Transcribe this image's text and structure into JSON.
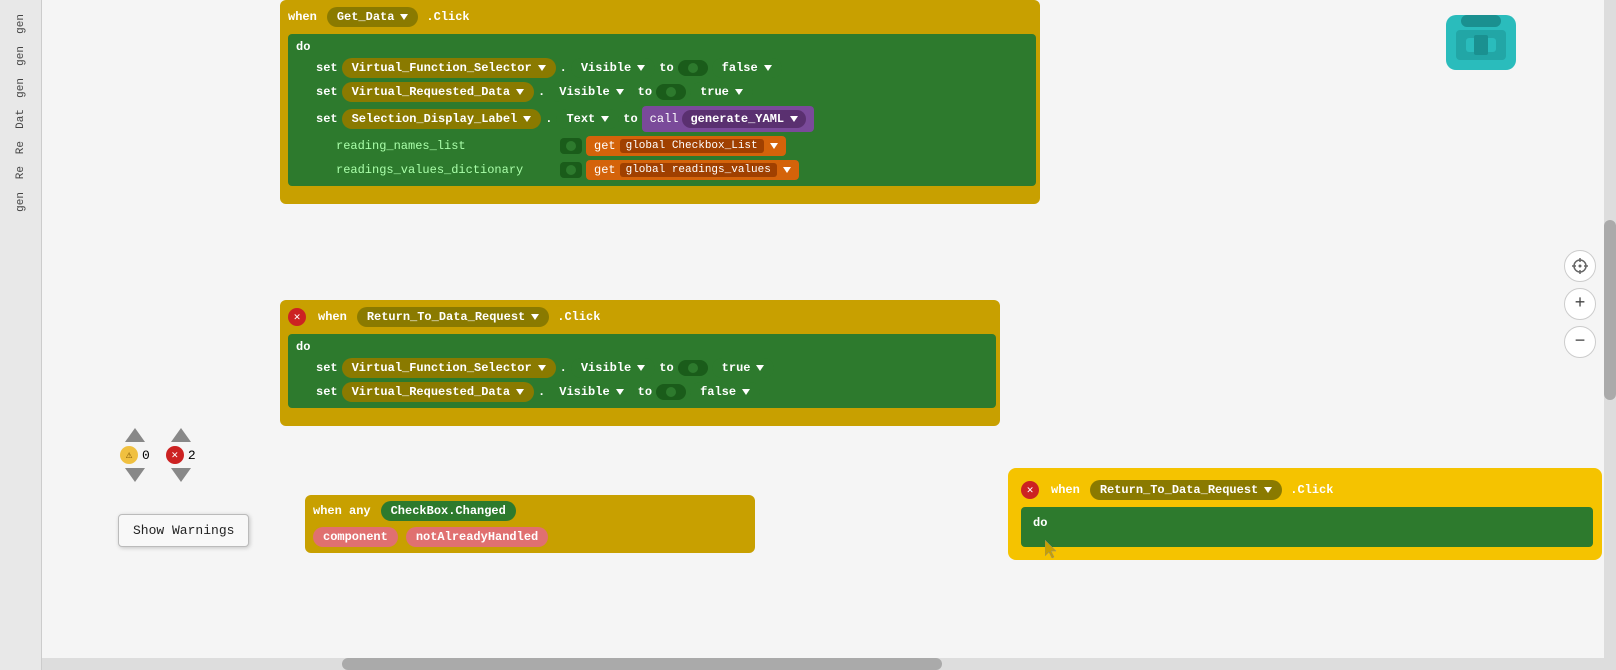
{
  "sidebar": {
    "items": [
      {
        "label": "gen"
      },
      {
        "label": "gen"
      },
      {
        "label": "gen"
      },
      {
        "label": "Dat"
      },
      {
        "label": "Re"
      },
      {
        "label": "Re"
      },
      {
        "label": "gen"
      }
    ]
  },
  "blocks": {
    "block1": {
      "when_label": "when",
      "event": "Get_Data",
      "click": ".Click",
      "do_label": "do",
      "rows": [
        {
          "set": "set",
          "component": "Virtual_Function_Selector",
          "property": "Visible",
          "to": "to",
          "value": "false"
        },
        {
          "set": "set",
          "component": "Virtual_Requested_Data",
          "property": "Visible",
          "to": "to",
          "value": "true"
        },
        {
          "set": "set",
          "component": "Selection_Display_Label",
          "property": "Text",
          "to": "to",
          "call": "call",
          "function": "generate_YAML",
          "param1_label": "reading_names_list",
          "param1_get": "get",
          "param1_value": "global Checkbox_List",
          "param2_label": "readings_values_dictionary",
          "param2_get": "get",
          "param2_value": "global readings_values"
        }
      ]
    },
    "block2": {
      "when_label": "when",
      "event": "Return_To_Data_Request",
      "click": ".Click",
      "do_label": "do",
      "rows": [
        {
          "set": "set",
          "component": "Virtual_Function_Selector",
          "property": "Visible",
          "to": "to",
          "value": "true"
        },
        {
          "set": "set",
          "component": "Virtual_Requested_Data",
          "property": "Visible",
          "to": "to",
          "value": "false"
        }
      ]
    },
    "block3": {
      "when_label": "when any",
      "event": "CheckBox.Changed",
      "param1": "component",
      "param2": "notAlreadyHandled"
    },
    "block4": {
      "when_label": "when",
      "event": "Return_To_Data_Request",
      "click": ".Click",
      "do_label": "do"
    }
  },
  "warnings": {
    "show_label": "Show Warnings",
    "warn_count": "0",
    "error_count": "2"
  },
  "zoom": {
    "crosshair": "⊕",
    "plus": "+",
    "minus": "−"
  }
}
